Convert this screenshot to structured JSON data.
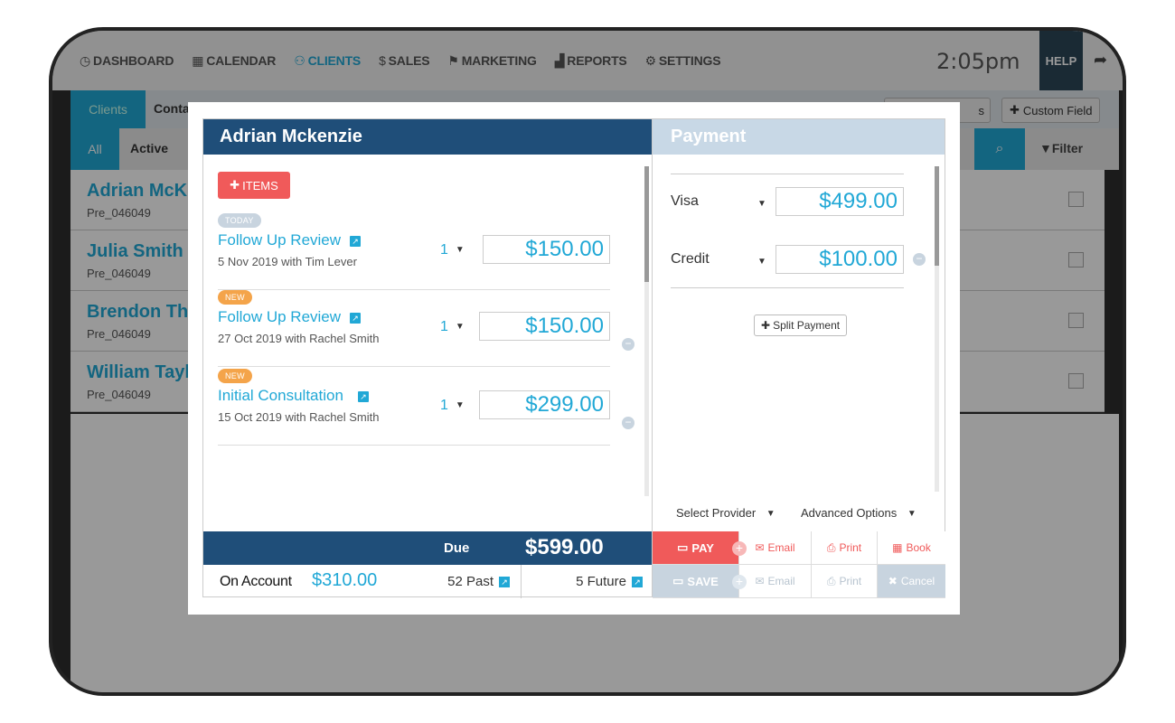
{
  "nav": {
    "items": [
      {
        "label": "DASHBOARD",
        "icon": "◷",
        "active": false
      },
      {
        "label": "CALENDAR",
        "icon": "▦",
        "active": false
      },
      {
        "label": "CLIENTS",
        "icon": "⚇",
        "active": true
      },
      {
        "label": "SALES",
        "icon": "$",
        "active": false
      },
      {
        "label": "MARKETING",
        "icon": "⚑",
        "active": false
      },
      {
        "label": "REPORTS",
        "icon": "▟",
        "active": false
      },
      {
        "label": "SETTINGS",
        "icon": "⚙",
        "active": false
      }
    ],
    "clock": "2:05pm",
    "help": "HELP"
  },
  "subbar": {
    "clients_tab": "Clients",
    "contacts_tab": "Conta",
    "extra_button": "s",
    "custom_field": "Custom Field"
  },
  "filterbar": {
    "all_tab": "All",
    "active_tab": "Active",
    "filter": "Filter"
  },
  "clients": [
    {
      "name": "Adrian McK",
      "id": "Pre_046049"
    },
    {
      "name": "Julia Smith",
      "id": "Pre_046049"
    },
    {
      "name": "Brendon Th",
      "id": "Pre_046049"
    },
    {
      "name": "William Tayl",
      "id": "Pre_046049"
    }
  ],
  "modal": {
    "client_name": "Adrian Mckenzie",
    "items_button": "ITEMS",
    "items": [
      {
        "badge": "TODAY",
        "title": "Follow Up Review",
        "subtitle": "5 Nov 2019 with Tim Lever",
        "qty": "1",
        "price": "$150.00"
      },
      {
        "badge": "NEW",
        "title": "Follow Up Review",
        "subtitle": "27 Oct 2019 with Rachel Smith",
        "qty": "1",
        "price": "$150.00"
      },
      {
        "badge": "NEW",
        "title": "Initial Consultation",
        "subtitle": "15 Oct 2019 with Rachel Smith",
        "qty": "1",
        "price": "$299.00"
      }
    ],
    "due_label": "Due",
    "due_amount": "$599.00",
    "on_account_label": "On Account",
    "on_account_amount": "$310.00",
    "past": "52 Past",
    "future": "5 Future",
    "payment": {
      "header": "Payment",
      "methods": [
        {
          "method": "Visa",
          "amount": "$499.00"
        },
        {
          "method": "Credit",
          "amount": "$100.00"
        }
      ],
      "split_payment": "Split Payment",
      "select_provider": "Select Provider",
      "advanced_options": "Advanced Options"
    },
    "actions": {
      "pay": "PAY",
      "save": "SAVE",
      "email": "Email",
      "print": "Print",
      "book": "Book",
      "cancel": "Cancel"
    }
  },
  "colors": {
    "accent": "#21a8d6",
    "header_navy": "#1f4e79",
    "pay_red": "#f05a5a",
    "muted": "#c8d4df",
    "new_badge": "#f4a44a"
  }
}
